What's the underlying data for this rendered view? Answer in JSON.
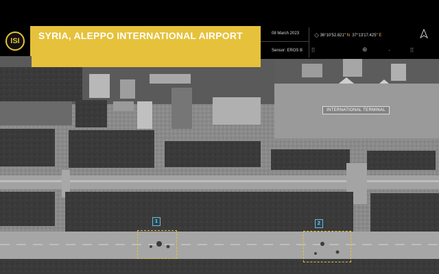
{
  "header": {
    "logo_text": "ISI",
    "title": "SYRIA, ALEPPO INTERNATIONAL AIRPORT"
  },
  "info": {
    "date": "08 March 2023",
    "sensor_label": "Sensor:",
    "sensor_value": "EROS B",
    "lat": "36°10'52.821\"",
    "lat_dir": "N",
    "lon": "37°13'17.425\"",
    "lon_dir": "E",
    "north_icon": "north-arrow-icon"
  },
  "labels": {
    "terminal": "INTERNATIONAL TERMINAL"
  },
  "markers": [
    {
      "id": "1"
    },
    {
      "id": "2"
    }
  ],
  "colors": {
    "accent": "#e6c13b",
    "marker_badge": "#1b4a5c"
  }
}
